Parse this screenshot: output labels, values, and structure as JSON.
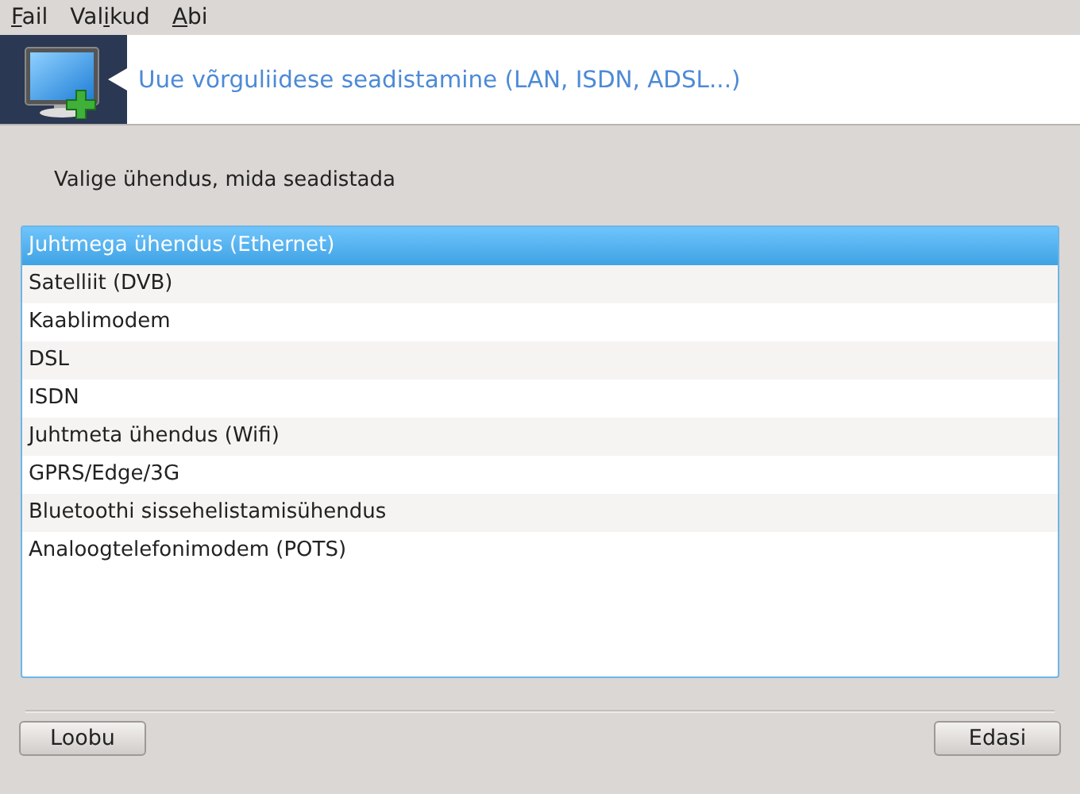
{
  "menu": [
    {
      "access_key": "F",
      "after": "ail"
    },
    {
      "before": "Val",
      "access_key": "i",
      "after": "kud"
    },
    {
      "access_key": "A",
      "after": "bi"
    }
  ],
  "header": {
    "title": "Uue võrguliidese seadistamine (LAN, ISDN, ADSL...)"
  },
  "prompt": "Valige ühendus, mida seadistada",
  "connections": [
    {
      "label": "Juhtmega ühendus (Ethernet)",
      "selected": true
    },
    {
      "label": "Satelliit (DVB)",
      "selected": false
    },
    {
      "label": "Kaablimodem",
      "selected": false
    },
    {
      "label": "DSL",
      "selected": false
    },
    {
      "label": "ISDN",
      "selected": false
    },
    {
      "label": "Juhtmeta ühendus (Wifi)",
      "selected": false
    },
    {
      "label": "GPRS/Edge/3G",
      "selected": false
    },
    {
      "label": "Bluetoothi sissehelistamisühendus",
      "selected": false
    },
    {
      "label": "Analoogtelefonimodem (POTS)",
      "selected": false
    }
  ],
  "buttons": {
    "cancel": "Loobu",
    "next": "Edasi"
  }
}
